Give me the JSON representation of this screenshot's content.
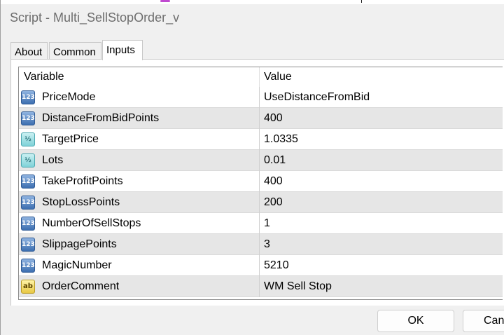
{
  "window": {
    "title": "Script - Multi_SellStopOrder_v"
  },
  "tabs": [
    {
      "label": "About"
    },
    {
      "label": "Common"
    },
    {
      "label": "Inputs",
      "active": true
    }
  ],
  "table": {
    "headers": {
      "variable": "Variable",
      "value": "Value"
    },
    "rows": [
      {
        "icon": "integer-icon",
        "icon_text": "123",
        "name": "PriceMode",
        "value": "UseDistanceFromBid"
      },
      {
        "icon": "integer-icon",
        "icon_text": "123",
        "name": "DistanceFromBidPoints",
        "value": "400"
      },
      {
        "icon": "double-icon",
        "icon_text": "½",
        "name": "TargetPrice",
        "value": "1.0335"
      },
      {
        "icon": "double-icon",
        "icon_text": "½",
        "name": "Lots",
        "value": "0.01"
      },
      {
        "icon": "integer-icon",
        "icon_text": "123",
        "name": "TakeProfitPoints",
        "value": "400"
      },
      {
        "icon": "integer-icon",
        "icon_text": "123",
        "name": "StopLossPoints",
        "value": "200"
      },
      {
        "icon": "integer-icon",
        "icon_text": "123",
        "name": "NumberOfSellStops",
        "value": "1"
      },
      {
        "icon": "integer-icon",
        "icon_text": "123",
        "name": "SlippagePoints",
        "value": "3"
      },
      {
        "icon": "integer-icon",
        "icon_text": "123",
        "name": "MagicNumber",
        "value": "5210"
      },
      {
        "icon": "string-icon",
        "icon_text": "ab",
        "name": "OrderComment",
        "value": "WM Sell Stop"
      }
    ]
  },
  "buttons": {
    "ok": "OK",
    "cancel": "Can"
  }
}
